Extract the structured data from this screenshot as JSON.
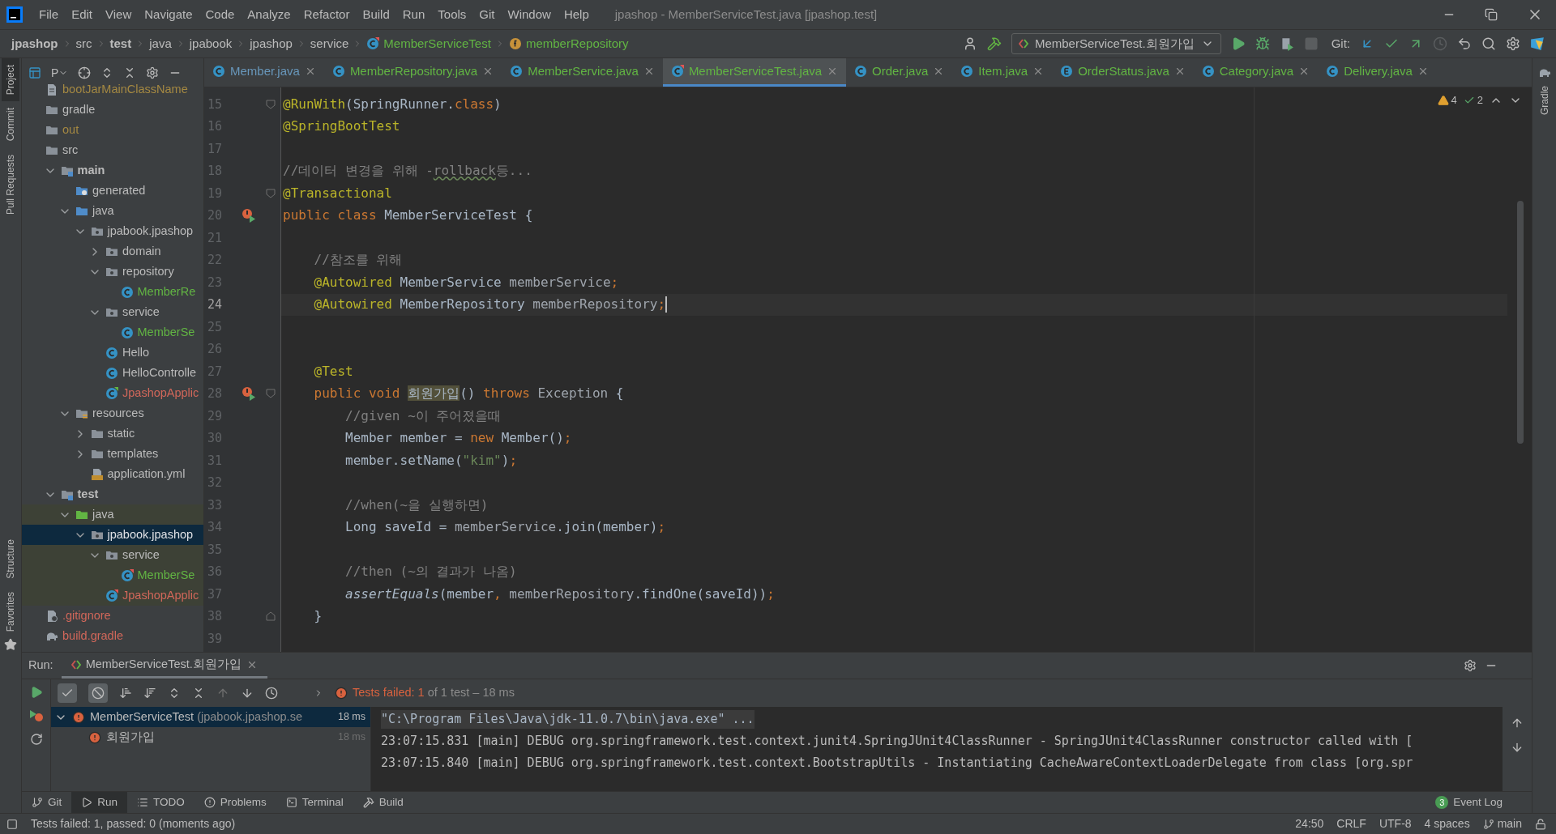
{
  "window": {
    "title": "jpashop - MemberServiceTest.java [jpashop.test]"
  },
  "menu": [
    "File",
    "Edit",
    "View",
    "Navigate",
    "Code",
    "Analyze",
    "Refactor",
    "Build",
    "Run",
    "Tools",
    "Git",
    "Window",
    "Help"
  ],
  "breadcrumbs": [
    {
      "label": "jpashop",
      "kind": "module"
    },
    {
      "label": "src",
      "kind": "dir"
    },
    {
      "label": "test",
      "kind": "module"
    },
    {
      "label": "java",
      "kind": "dir"
    },
    {
      "label": "jpabook",
      "kind": "dir"
    },
    {
      "label": "jpashop",
      "kind": "dir"
    },
    {
      "label": "service",
      "kind": "dir"
    },
    {
      "label": "MemberServiceTest",
      "kind": "class"
    },
    {
      "label": "memberRepository",
      "kind": "field"
    }
  ],
  "run_config": {
    "label": "MemberServiceTest.회원가입"
  },
  "git_label": "Git:",
  "side_tools_left": [
    {
      "label": "Project",
      "selected": true
    },
    {
      "label": "Commit",
      "selected": false
    },
    {
      "label": "Pull Requests",
      "selected": false
    }
  ],
  "side_tools_left_bottom": [
    {
      "label": "Structure",
      "selected": false
    },
    {
      "label": "Favorites",
      "selected": false
    }
  ],
  "side_tools_right": [
    {
      "label": "Gradle",
      "selected": false
    }
  ],
  "project_panel": {
    "view_label": "P"
  },
  "tree": [
    {
      "label": "bootJarMainClassName",
      "kind": "file",
      "color": "#a48842",
      "selected": false
    },
    {
      "label": "gradle",
      "kind": "folder",
      "color": "#bbbbbb",
      "selected": false
    },
    {
      "label": "out",
      "kind": "folder",
      "color": "#a48842",
      "selected": false
    },
    {
      "label": "src",
      "kind": "folder",
      "color": "#bbbbbb",
      "selected": false,
      "children": [
        {
          "label": "main",
          "kind": "module",
          "color": "#bbbbbb",
          "bold": true,
          "expanded": true,
          "selected": false,
          "children": [
            {
              "label": "generated",
              "kind": "generated",
              "color": "#bbbbbb",
              "selected": false
            },
            {
              "label": "java",
              "kind": "source",
              "color": "#bbbbbb",
              "expanded": true,
              "selected": false,
              "children": [
                {
                  "label": "jpabook.jpashop",
                  "kind": "package",
                  "color": "#bbbbbb",
                  "expanded": true,
                  "selected": false,
                  "children": [
                    {
                      "label": "domain",
                      "kind": "package",
                      "color": "#bbbbbb",
                      "expanded": false,
                      "selected": false
                    },
                    {
                      "label": "repository",
                      "kind": "package",
                      "color": "#bbbbbb",
                      "expanded": true,
                      "selected": false,
                      "children": [
                        {
                          "label": "MemberRe",
                          "kind": "class",
                          "color": "#62b543",
                          "selected": false
                        }
                      ]
                    },
                    {
                      "label": "service",
                      "kind": "package",
                      "color": "#bbbbbb",
                      "expanded": true,
                      "selected": false,
                      "children": [
                        {
                          "label": "MemberSe",
                          "kind": "class",
                          "color": "#62b543",
                          "selected": false
                        }
                      ]
                    },
                    {
                      "label": "Hello",
                      "kind": "class",
                      "color": "#bbbbbb",
                      "selected": false
                    },
                    {
                      "label": "HelloControlle",
                      "kind": "class",
                      "color": "#bbbbbb",
                      "selected": false
                    },
                    {
                      "label": "JpashopApplic",
                      "kind": "app-class",
                      "color": "#d1675a",
                      "selected": false
                    }
                  ]
                }
              ]
            },
            {
              "label": "resources",
              "kind": "resources",
              "color": "#bbbbbb",
              "expanded": true,
              "selected": false,
              "children": [
                {
                  "label": "static",
                  "kind": "folder",
                  "color": "#bbbbbb",
                  "expanded": false,
                  "selected": false
                },
                {
                  "label": "templates",
                  "kind": "folder",
                  "color": "#bbbbbb",
                  "expanded": false,
                  "selected": false
                },
                {
                  "label": "application.yml",
                  "kind": "yml",
                  "color": "#bbbbbb",
                  "selected": false
                }
              ]
            }
          ]
        },
        {
          "label": "test",
          "kind": "module",
          "color": "#bbbbbb",
          "bold": true,
          "expanded": true,
          "selected": false,
          "children": [
            {
              "label": "java",
              "kind": "test-source",
              "color": "#bbbbbb",
              "expanded": true,
              "selected": false,
              "children": [
                {
                  "label": "jpabook.jpashop",
                  "kind": "package",
                  "expanded": true,
                  "selected": true,
                  "children": [
                    {
                      "label": "service",
                      "kind": "package",
                      "color": "#bbbbbb",
                      "expanded": true,
                      "selected": false,
                      "children": [
                        {
                          "label": "MemberSe",
                          "kind": "test-class",
                          "color": "#62b543",
                          "selected": false
                        }
                      ]
                    },
                    {
                      "label": "JpashopApplic",
                      "kind": "test-class",
                      "color": "#d1675a",
                      "selected": false
                    }
                  ]
                }
              ]
            }
          ]
        }
      ]
    },
    {
      "label": ".gitignore",
      "kind": "ignore-file",
      "color": "#d1675a",
      "selected": false
    },
    {
      "label": "build.gradle",
      "kind": "gradle",
      "color": "#d1675a",
      "selected": false
    }
  ],
  "tabs": [
    {
      "label": "Member.java",
      "kind": "class",
      "color": "#6897bb",
      "selected": false
    },
    {
      "label": "MemberRepository.java",
      "kind": "class",
      "color": "#62b543",
      "selected": false
    },
    {
      "label": "MemberService.java",
      "kind": "class",
      "color": "#62b543",
      "selected": false
    },
    {
      "label": "MemberServiceTest.java",
      "kind": "test-class",
      "color": "#62b543",
      "selected": true
    },
    {
      "label": "Order.java",
      "kind": "class",
      "color": "#62b543",
      "selected": false
    },
    {
      "label": "Item.java",
      "kind": "abstract",
      "color": "#62b543",
      "selected": false
    },
    {
      "label": "OrderStatus.java",
      "kind": "enum",
      "color": "#62b543",
      "selected": false
    },
    {
      "label": "Category.java",
      "kind": "class",
      "color": "#62b543",
      "selected": false
    },
    {
      "label": "Delivery.java",
      "kind": "class",
      "color": "#62b543",
      "selected": false
    }
  ],
  "inspections": {
    "warnings": "4",
    "weak_warnings": "2"
  },
  "code": [
    {
      "number": "15",
      "current": false,
      "fold_start": true,
      "tokens": [
        {
          "kind": "ann",
          "text": "@RunWith"
        },
        {
          "kind": "txt",
          "text": "(SpringRunner."
        },
        {
          "kind": "kw",
          "text": "class"
        },
        {
          "kind": "txt",
          "text": ")"
        }
      ]
    },
    {
      "number": "16",
      "current": false,
      "tokens": [
        {
          "kind": "ann",
          "text": "@SpringBootTest"
        }
      ]
    },
    {
      "number": "17",
      "current": false
    },
    {
      "number": "18",
      "current": false,
      "tokens": [
        {
          "kind": "cmt",
          "text": "//데이터 변경을 위해 -"
        },
        {
          "kind": "typo",
          "text": "rollback"
        },
        {
          "kind": "cmt",
          "text": "등..."
        }
      ]
    },
    {
      "number": "19",
      "current": false,
      "fold_start": true,
      "tokens": [
        {
          "kind": "ann",
          "text": "@Transactional"
        }
      ]
    },
    {
      "number": "20",
      "current": false,
      "test_failed": true,
      "tokens": [
        {
          "kind": "kw",
          "text": "public class "
        },
        {
          "kind": "txt",
          "text": "MemberServiceTest {"
        }
      ]
    },
    {
      "number": "21",
      "current": false
    },
    {
      "number": "22",
      "current": false,
      "tokens": [
        {
          "kind": "cmt",
          "text": "    //참조를 위해"
        }
      ]
    },
    {
      "number": "23",
      "current": false,
      "tokens": [
        {
          "kind": "ann",
          "text": "    @Autowired "
        },
        {
          "kind": "txt",
          "text": "MemberService "
        },
        {
          "kind": "fld",
          "text": "memberService"
        },
        {
          "kind": "kw",
          "text": ";"
        }
      ]
    },
    {
      "number": "24",
      "current": true,
      "tokens": [
        {
          "kind": "ann",
          "text": "    @Autowired "
        },
        {
          "kind": "txt",
          "text": "MemberRepository "
        },
        {
          "kind": "fld",
          "text": "memberRepository"
        },
        {
          "kind": "kw",
          "text": ";"
        }
      ]
    },
    {
      "number": "25",
      "current": false
    },
    {
      "number": "26",
      "current": false
    },
    {
      "number": "27",
      "current": false,
      "tokens": [
        {
          "kind": "ann",
          "text": "    @Test"
        }
      ]
    },
    {
      "number": "28",
      "current": false,
      "test_failed": true,
      "fold_start": true,
      "tokens": [
        {
          "kind": "kw",
          "text": "    public void "
        },
        {
          "kind": "hl",
          "text": "회원가입"
        },
        {
          "kind": "txt",
          "text": "() "
        },
        {
          "kind": "kw",
          "text": "throws "
        },
        {
          "kind": "fld",
          "text": "Exception "
        },
        {
          "kind": "txt",
          "text": "{"
        }
      ]
    },
    {
      "number": "29",
      "current": false,
      "tokens": [
        {
          "kind": "cmt",
          "text": "        //given ~이 주어졌을때"
        }
      ]
    },
    {
      "number": "30",
      "current": false,
      "tokens": [
        {
          "kind": "txt",
          "text": "        Member member = "
        },
        {
          "kind": "kw",
          "text": "new "
        },
        {
          "kind": "txt",
          "text": "Member()"
        },
        {
          "kind": "kw",
          "text": ";"
        }
      ]
    },
    {
      "number": "31",
      "current": false,
      "tokens": [
        {
          "kind": "txt",
          "text": "        member.setName("
        },
        {
          "kind": "str",
          "text": "\"kim\""
        },
        {
          "kind": "txt",
          "text": ")"
        },
        {
          "kind": "kw",
          "text": ";"
        }
      ]
    },
    {
      "number": "32",
      "current": false
    },
    {
      "number": "33",
      "current": false,
      "tokens": [
        {
          "kind": "cmt",
          "text": "        //when(~을 실행하면)"
        }
      ]
    },
    {
      "number": "34",
      "current": false,
      "tokens": [
        {
          "kind": "txt",
          "text": "        Long saveId = "
        },
        {
          "kind": "fld",
          "text": "memberService"
        },
        {
          "kind": "txt",
          "text": ".join(member)"
        },
        {
          "kind": "kw",
          "text": ";"
        }
      ]
    },
    {
      "number": "35",
      "current": false
    },
    {
      "number": "36",
      "current": false,
      "tokens": [
        {
          "kind": "cmt",
          "text": "        //then (~의 결과가 나옴)"
        }
      ]
    },
    {
      "number": "37",
      "current": false,
      "tokens": [
        {
          "kind": "ital",
          "text": "        assertEquals"
        },
        {
          "kind": "txt",
          "text": "(member"
        },
        {
          "kind": "kw",
          "text": ", "
        },
        {
          "kind": "fld",
          "text": "memberRepository"
        },
        {
          "kind": "txt",
          "text": ".findOne(saveId))"
        },
        {
          "kind": "kw",
          "text": ";"
        }
      ]
    },
    {
      "number": "38",
      "current": false,
      "fold_end": true,
      "tokens": [
        {
          "kind": "txt",
          "text": "    }"
        }
      ]
    },
    {
      "number": "39",
      "current": false
    }
  ],
  "run_panel": {
    "label": "Run:",
    "tab": "MemberServiceTest.회원가입",
    "summary": {
      "failed": "Tests failed: 1",
      "rest": "of 1 test – 18 ms"
    },
    "results": [
      {
        "label": "MemberServiceTest",
        "detail": "(jpabook.jpashop.se",
        "time": "18 ms",
        "failed": true,
        "expanded": true,
        "selected": true,
        "children": [
          {
            "label": "회원가입",
            "time": "18 ms",
            "failed": true,
            "selected": false
          }
        ]
      }
    ],
    "console": [
      {
        "text": "\"C:\\Program Files\\Java\\jdk-11.0.7\\bin\\java.exe\" ...",
        "kind": "command"
      },
      {
        "text": "23:07:15.831 [main] DEBUG org.springframework.test.context.junit4.SpringJUnit4ClassRunner - SpringJUnit4ClassRunner constructor called with [",
        "kind": "log"
      },
      {
        "text": "23:07:15.840 [main] DEBUG org.springframework.test.context.BootstrapUtils - Instantiating CacheAwareContextLoaderDelegate from class [org.spr",
        "kind": "log"
      }
    ]
  },
  "tool_tabs": [
    {
      "label": "Git",
      "kind": "git",
      "selected": false
    },
    {
      "label": "Run",
      "kind": "run",
      "selected": true
    },
    {
      "label": "TODO",
      "kind": "todo",
      "selected": false
    },
    {
      "label": "Problems",
      "kind": "problems",
      "selected": false
    },
    {
      "label": "Terminal",
      "kind": "terminal",
      "selected": false
    },
    {
      "label": "Build",
      "kind": "build",
      "selected": false
    }
  ],
  "event_log": {
    "label": "Event Log",
    "count": "3"
  },
  "status_bar": {
    "message": "Tests failed: 1, passed: 0 (moments ago)",
    "position": "24:50",
    "line_separator": "CRLF",
    "encoding": "UTF-8",
    "indent": "4 spaces",
    "branch": "main"
  }
}
